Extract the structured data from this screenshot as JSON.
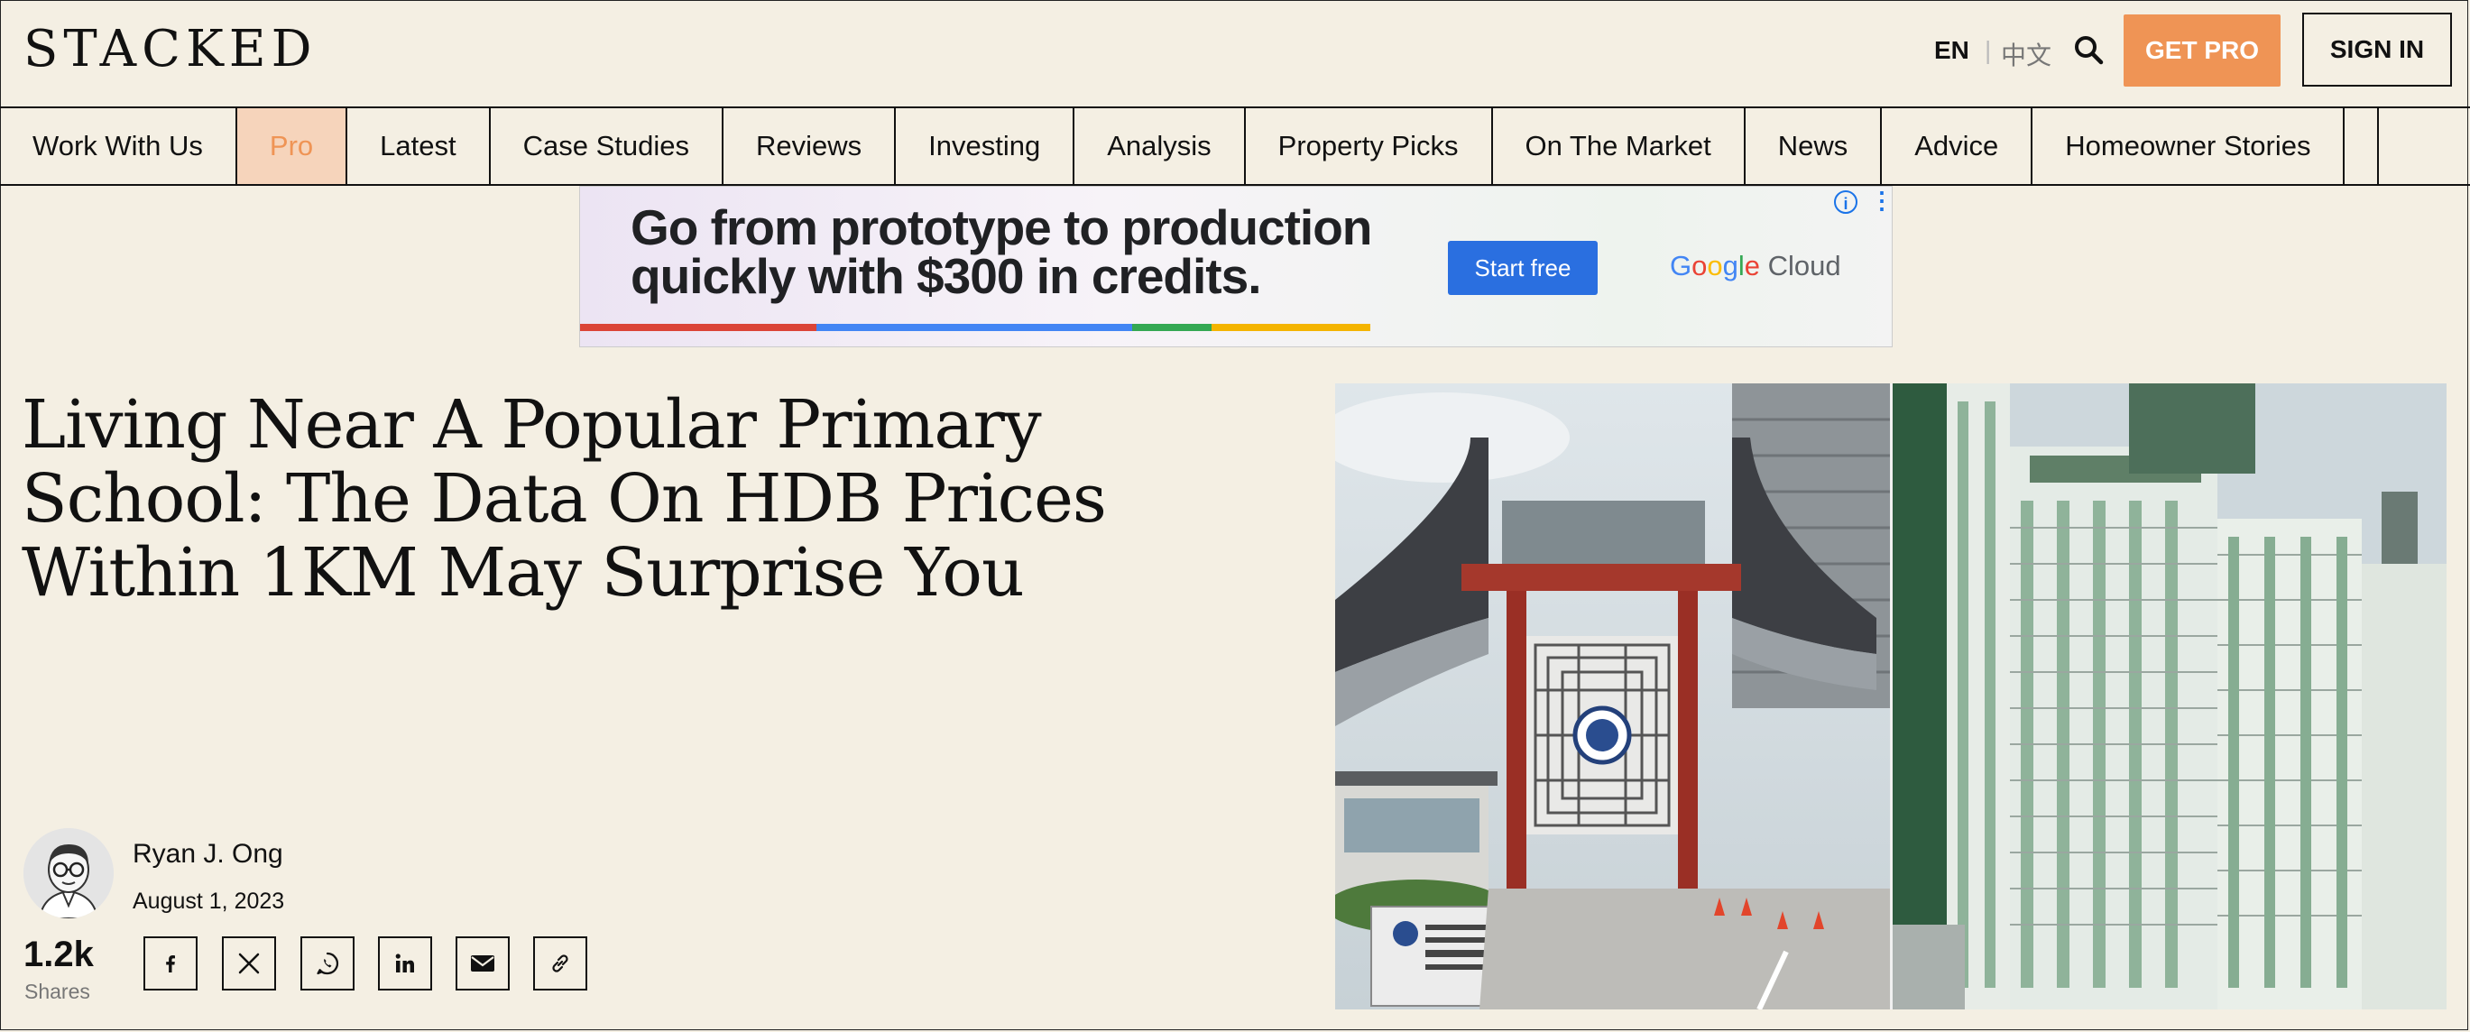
{
  "header": {
    "logo": "STACKED",
    "lang_en": "EN",
    "lang_sep": "|",
    "lang_zh": "中文",
    "search_icon": "search-icon",
    "get_pro_label": "GET PRO",
    "sign_in_label": "SIGN IN"
  },
  "nav": {
    "items": [
      {
        "label": "Work With Us"
      },
      {
        "label": "Pro"
      },
      {
        "label": "Latest"
      },
      {
        "label": "Case Studies"
      },
      {
        "label": "Reviews"
      },
      {
        "label": "Investing"
      },
      {
        "label": "Analysis"
      },
      {
        "label": "Property Picks"
      },
      {
        "label": "On The Market"
      },
      {
        "label": "News"
      },
      {
        "label": "Advice"
      },
      {
        "label": "Homeowner Stories"
      }
    ]
  },
  "ad": {
    "headline_line1": "Go from prototype to production",
    "headline_line2": "quickly with $300 in credits.",
    "cta": "Start free",
    "brand_g": "G",
    "brand_o1": "o",
    "brand_o2": "o",
    "brand_g2": "g",
    "brand_l": "l",
    "brand_e": "e",
    "brand_rest": " Cloud",
    "info_label": "i",
    "more_label": "⋮"
  },
  "article": {
    "title": "Living Near A Popular Primary School: The Data On HDB Prices Within 1KM May Surprise You",
    "author": "Ryan J. Ong",
    "date": "August 1, 2023",
    "shares_count": "1.2k",
    "shares_label": "Shares"
  },
  "share_buttons": [
    "facebook-icon",
    "x-icon",
    "whatsapp-icon",
    "linkedin-icon",
    "email-icon",
    "link-icon"
  ],
  "colors": {
    "background": "#f4efe3",
    "accent": "#ef9455",
    "pro_tab_bg": "#f6d4bb",
    "ad_cta": "#2a6fe0"
  }
}
